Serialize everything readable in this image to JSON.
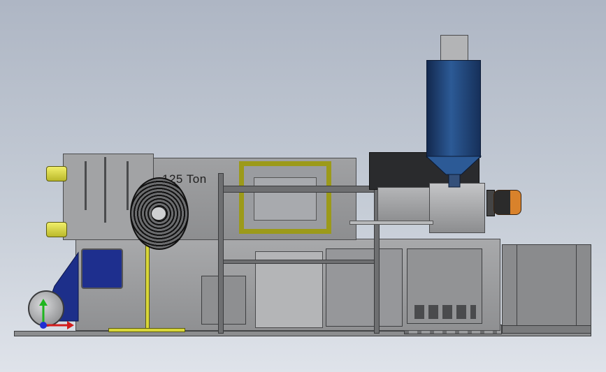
{
  "machine": {
    "tonnage_label": "125 Ton"
  },
  "colors": {
    "background_top": "#aeb6c4",
    "background_bottom": "#dfe3ea",
    "machine_gray": "#9a9b9d",
    "hopper_blue": "#1f3f6f",
    "frame_yellow": "#9c9a1a",
    "cylinder_yellow": "#e3e03a",
    "motor_orange": "#d9822b"
  },
  "triad": {
    "x_axis_color": "#d21c1c",
    "y_axis_color": "#1fb51f",
    "z_axis_color": "#1f2fd2"
  }
}
